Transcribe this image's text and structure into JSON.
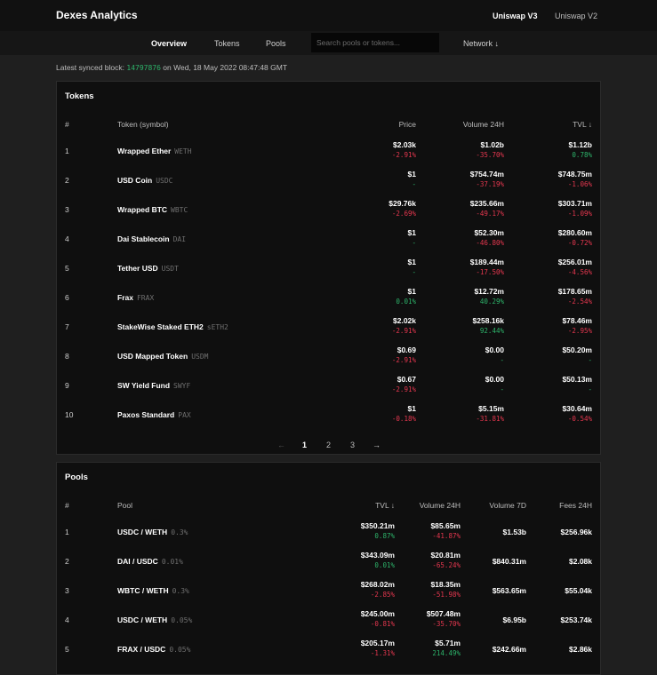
{
  "app": {
    "title": "Dexes Analytics",
    "versions": [
      "Uniswap V3",
      "Uniswap V2"
    ]
  },
  "nav": {
    "items": [
      "Overview",
      "Tokens",
      "Pools"
    ],
    "search_placeholder": "Search pools or tokens...",
    "network": "Network ↓"
  },
  "sync": {
    "prefix": "Latest synced block:",
    "block": "14797876",
    "on": "on",
    "date": "Wed, 18 May 2022 08:47:48 GMT"
  },
  "tokens": {
    "title": "Tokens",
    "headers": [
      "#",
      "Token (symbol)",
      "Price",
      "Volume 24H",
      "TVL ↓"
    ],
    "rows": [
      {
        "n": "1",
        "name": "Wrapped Ether",
        "sym": "WETH",
        "price": "$2.03k",
        "price_chg": "-2.91%",
        "vol": "$1.02b",
        "vol_chg": "-35.70%",
        "tvl": "$1.12b",
        "tvl_chg": "0.78%"
      },
      {
        "n": "2",
        "name": "USD Coin",
        "sym": "USDC",
        "price": "$1",
        "price_chg": "-",
        "vol": "$754.74m",
        "vol_chg": "-37.19%",
        "tvl": "$748.75m",
        "tvl_chg": "-1.06%"
      },
      {
        "n": "3",
        "name": "Wrapped BTC",
        "sym": "WBTC",
        "price": "$29.76k",
        "price_chg": "-2.69%",
        "vol": "$235.66m",
        "vol_chg": "-49.17%",
        "tvl": "$303.71m",
        "tvl_chg": "-1.09%"
      },
      {
        "n": "4",
        "name": "Dai Stablecoin",
        "sym": "DAI",
        "price": "$1",
        "price_chg": "-",
        "vol": "$52.30m",
        "vol_chg": "-46.80%",
        "tvl": "$280.60m",
        "tvl_chg": "-0.72%"
      },
      {
        "n": "5",
        "name": "Tether USD",
        "sym": "USDT",
        "price": "$1",
        "price_chg": "-",
        "vol": "$189.44m",
        "vol_chg": "-17.50%",
        "tvl": "$256.01m",
        "tvl_chg": "-4.56%"
      },
      {
        "n": "6",
        "name": "Frax",
        "sym": "FRAX",
        "price": "$1",
        "price_chg": "0.01%",
        "vol": "$12.72m",
        "vol_chg": "40.29%",
        "tvl": "$178.65m",
        "tvl_chg": "-2.54%"
      },
      {
        "n": "7",
        "name": "StakeWise Staked ETH2",
        "sym": "sETH2",
        "price": "$2.02k",
        "price_chg": "-2.91%",
        "vol": "$258.16k",
        "vol_chg": "92.44%",
        "tvl": "$78.46m",
        "tvl_chg": "-2.95%"
      },
      {
        "n": "8",
        "name": "USD Mapped Token",
        "sym": "USDM",
        "price": "$0.69",
        "price_chg": "-2.91%",
        "vol": "$0.00",
        "vol_chg": "-",
        "tvl": "$50.20m",
        "tvl_chg": "-"
      },
      {
        "n": "9",
        "name": "SW Yield Fund",
        "sym": "SWYF",
        "price": "$0.67",
        "price_chg": "-2.91%",
        "vol": "$0.00",
        "vol_chg": "-",
        "tvl": "$50.13m",
        "tvl_chg": "-"
      },
      {
        "n": "10",
        "name": "Paxos Standard",
        "sym": "PAX",
        "price": "$1",
        "price_chg": "-0.18%",
        "vol": "$5.15m",
        "vol_chg": "-31.81%",
        "tvl": "$30.64m",
        "tvl_chg": "-0.54%"
      }
    ],
    "pager": {
      "prev": "←",
      "pages": [
        "1",
        "2",
        "3"
      ],
      "next": "→"
    }
  },
  "pools": {
    "title": "Pools",
    "headers": [
      "#",
      "Pool",
      "TVL ↓",
      "Volume 24H",
      "Volume 7D",
      "Fees 24H"
    ],
    "rows": [
      {
        "n": "1",
        "name": "USDC / WETH",
        "fee": "0.3%",
        "tvl": "$350.21m",
        "tvl_chg": "0.87%",
        "vol": "$85.65m",
        "vol_chg": "-41.87%",
        "vol7": "$1.53b",
        "fees": "$256.96k"
      },
      {
        "n": "2",
        "name": "DAI / USDC",
        "fee": "0.01%",
        "tvl": "$343.09m",
        "tvl_chg": "0.01%",
        "vol": "$20.81m",
        "vol_chg": "-65.24%",
        "vol7": "$840.31m",
        "fees": "$2.08k"
      },
      {
        "n": "3",
        "name": "WBTC / WETH",
        "fee": "0.3%",
        "tvl": "$268.02m",
        "tvl_chg": "-2.85%",
        "vol": "$18.35m",
        "vol_chg": "-51.98%",
        "vol7": "$563.65m",
        "fees": "$55.04k"
      },
      {
        "n": "4",
        "name": "USDC / WETH",
        "fee": "0.05%",
        "tvl": "$245.00m",
        "tvl_chg": "-0.81%",
        "vol": "$507.48m",
        "vol_chg": "-35.70%",
        "vol7": "$6.95b",
        "fees": "$253.74k"
      },
      {
        "n": "5",
        "name": "FRAX / USDC",
        "fee": "0.05%",
        "tvl": "$205.17m",
        "tvl_chg": "-1.31%",
        "vol": "$5.71m",
        "vol_chg": "214.49%",
        "vol7": "$242.66m",
        "fees": "$2.86k"
      }
    ]
  },
  "colors": {
    "bg": "#1f1f1f",
    "panel": "#0f0f0f",
    "positive": "#2db36a",
    "negative": "#e5374f"
  }
}
